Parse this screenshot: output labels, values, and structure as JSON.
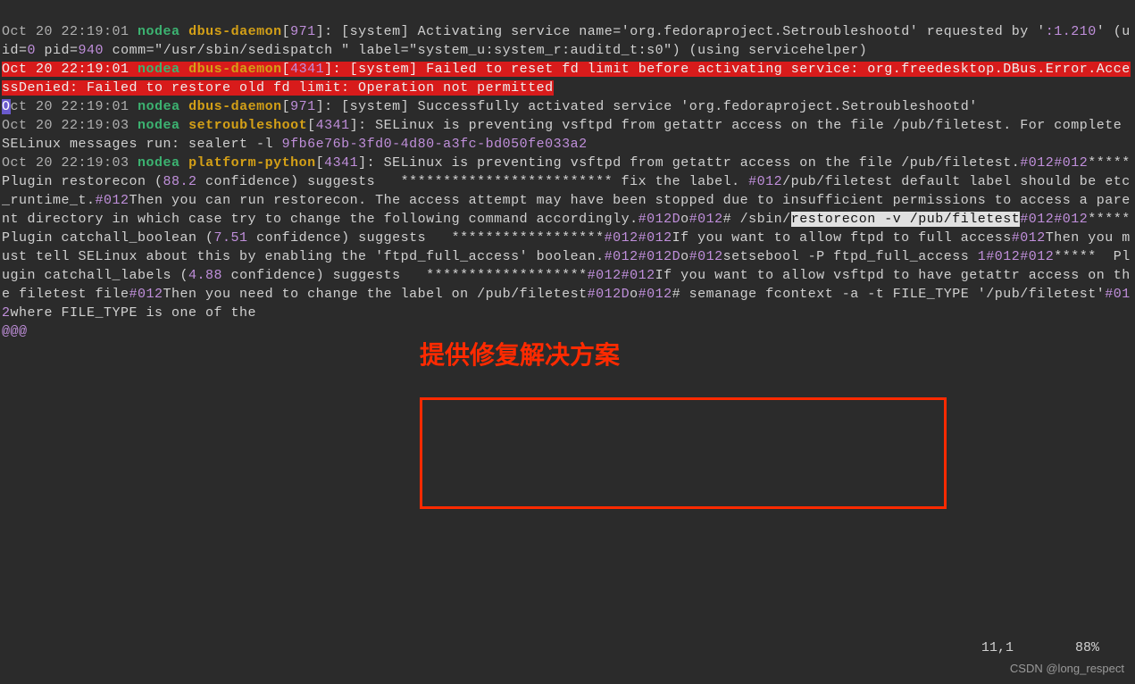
{
  "log_lines": [
    {
      "date": "Oct 20 22:19:01",
      "host": "nodea",
      "proc": "dbus-daemon",
      "pid": "971",
      "msg_pre": "[system] Activating service name='org.fedoraproject.Setroubleshootd' requested by '",
      "num1": ":1.210",
      "msg_mid1": "' (uid=",
      "num2": "0",
      "msg_mid2": " pid=",
      "num3": "940",
      "msg_post": " comm=\"/usr/sbin/sedispatch \" label=\"system_u:system_r:auditd_t:s0\") (using servicehelper)"
    },
    {
      "type": "error",
      "date": "Oct 20 22:19:01",
      "host": "nodea",
      "proc": "dbus-daemon",
      "pid": "4341",
      "msg": "[system] Failed to reset fd limit before activating service: org.freedesktop.DBus.Error.AccessDenied: Failed to restore old fd limit: Operation not permitted"
    },
    {
      "type": "cursor",
      "date_first": "O",
      "date_rest": "ct 20 22:19:01",
      "host": "nodea",
      "proc": "dbus-daemon",
      "pid": "971",
      "msg": "[system] Successfully activated service 'org.fedoraproject.Setroubleshootd'"
    },
    {
      "date": "Oct 20 22:19:03",
      "host": "nodea",
      "proc": "setroubleshoot",
      "pid": "4341",
      "msg_pre": "SELinux is preventing vsftpd from getattr access on the file /pub/filetest. For complete SELinux messages run: sealert -l ",
      "uuid": "9fb6e76b-3fd0-4d80-a3fc-bd050fe033a2"
    },
    {
      "type": "long",
      "date": "Oct 20 22:19:03",
      "host": "nodea",
      "proc": "platform-python",
      "pid": "4341",
      "body_pre1": "SELinux is preventing vsftpd from getattr access on the file /pub/filetest.",
      "h1": "#012#012",
      "body1": "*****  Plugin restorecon (",
      "conf1": "88.2",
      "body2": " confidence) suggests   ************************* fix the label. ",
      "h2": "#012",
      "body3": "/pub/filetest default label should be etc_runtime_t.",
      "h3": "#012",
      "body4": "Then you can run restorecon. The access attempt may have been stopped due to insufficient permissions to access a parent directory in which case try to change the following command accordingly.",
      "h4": "#012D",
      "o1": "o",
      "h5": "#012",
      "body5": "# /sbin/",
      "cmd_hl": "restorecon -v /pub/filetest",
      "h6": "#012#012",
      "body6": "*****  Plugin catchall_boolean (",
      "conf2": "7.51",
      "body7": " confidence) suggests   ******************",
      "h7": "#012#012",
      "body8": "If you want to allow ftpd to full access",
      "h8": "#012",
      "body9": "Then you must tell SELinux about this by enabling the 'ftpd_full_access' boolean.",
      "h9": "#012#012D",
      "o2": "o",
      "h10": "#012",
      "body10": "setsebool -P ftpd_full_access ",
      "one": "1",
      "h11": "#012#012",
      "body11": "*****  Plugin catchall_labels (",
      "conf3": "4.88",
      "body12": " confidence) suggests   *******************",
      "h12": "#012#012",
      "body13": "If you want to allow vsftpd to have getattr access on the filetest file",
      "h13": "#012",
      "body14": "Then you need to change the label on /pub/filetest",
      "h14": "#012D",
      "o3": "o",
      "h15": "#012",
      "body15": "# semanage fcontext -a -t FILE_TYPE '/pub/filetest'",
      "h16": "#012",
      "body16": "where FILE_TYPE is one of the "
    }
  ],
  "trailing": "@@@",
  "annotation": {
    "text": "提供修复解决方案"
  },
  "status": {
    "pos": "11,1",
    "pct": "88%"
  },
  "watermark": "CSDN @long_respect"
}
